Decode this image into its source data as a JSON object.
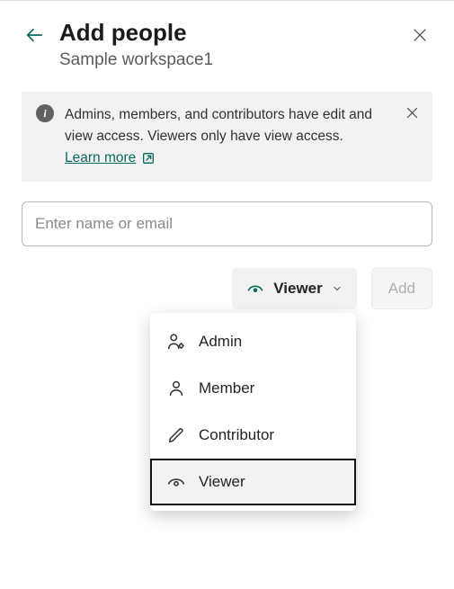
{
  "header": {
    "title": "Add people",
    "subtitle": "Sample workspace1"
  },
  "info": {
    "text": "Admins, members, and contributors have edit and view access. Viewers only have view access. ",
    "learn_label": "Learn more"
  },
  "input": {
    "placeholder": "Enter name or email"
  },
  "actions": {
    "role_label": "Viewer",
    "add_label": "Add"
  },
  "menu": {
    "items": [
      {
        "label": "Admin"
      },
      {
        "label": "Member"
      },
      {
        "label": "Contributor"
      },
      {
        "label": "Viewer"
      }
    ],
    "selected_index": 3
  }
}
